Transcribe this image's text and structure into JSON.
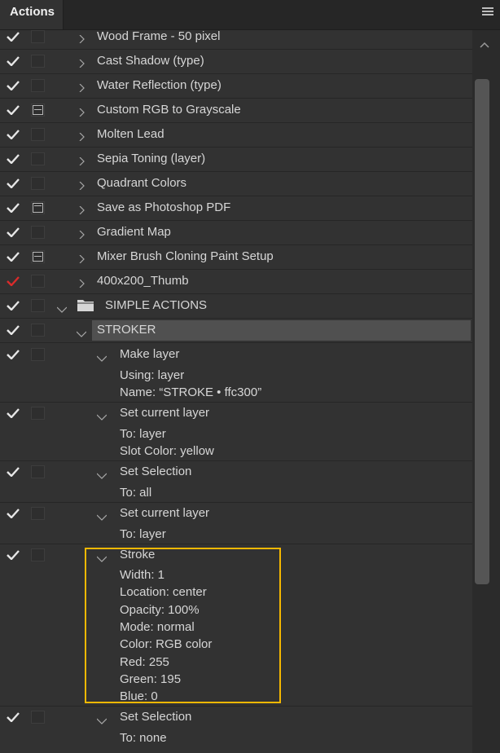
{
  "panel": {
    "tab_label": "Actions",
    "menu_icon": "hamburger-menu-icon"
  },
  "actions": [
    {
      "label": "Wood Frame - 50 pixel",
      "check": "white",
      "dialog": "none"
    },
    {
      "label": "Cast Shadow (type)",
      "check": "white",
      "dialog": "none"
    },
    {
      "label": "Water Reflection (type)",
      "check": "white",
      "dialog": "none"
    },
    {
      "label": "Custom RGB to Grayscale",
      "check": "white",
      "dialog": "partial"
    },
    {
      "label": "Molten Lead",
      "check": "white",
      "dialog": "none"
    },
    {
      "label": "Sepia Toning (layer)",
      "check": "white",
      "dialog": "none"
    },
    {
      "label": "Quadrant Colors",
      "check": "white",
      "dialog": "none"
    },
    {
      "label": "Save as Photoshop PDF",
      "check": "white",
      "dialog": "full"
    },
    {
      "label": "Gradient Map",
      "check": "white",
      "dialog": "none"
    },
    {
      "label": "Mixer Brush Cloning Paint Setup",
      "check": "white",
      "dialog": "partial"
    },
    {
      "label": "400x200_Thumb",
      "check": "red",
      "dialog": "none"
    }
  ],
  "set": {
    "label": "SIMPLE ACTIONS",
    "action": "STROKER"
  },
  "steps": [
    {
      "label": "Make layer",
      "details": [
        "Using: layer",
        "Name:  “STROKE • ffc300”"
      ]
    },
    {
      "label": "Set current layer",
      "details": [
        "To: layer",
        "Slot Color: yellow"
      ]
    },
    {
      "label": "Set Selection",
      "details": [
        "To: all"
      ]
    },
    {
      "label": "Set current layer",
      "details": [
        "To: layer"
      ]
    },
    {
      "label": "Stroke",
      "details": [
        "Width: 1",
        "Location: center",
        "Opacity: 100%",
        "Mode: normal",
        "Color: RGB color",
        "Red: 255",
        "Green: 195",
        "Blue: 0"
      ]
    },
    {
      "label": "Set Selection",
      "details": [
        "To: none"
      ]
    }
  ],
  "colors": {
    "highlight": "#f5b800",
    "check_red": "#d92b2b",
    "check_white": "#e6e6e6",
    "selected_row": "#505050"
  }
}
